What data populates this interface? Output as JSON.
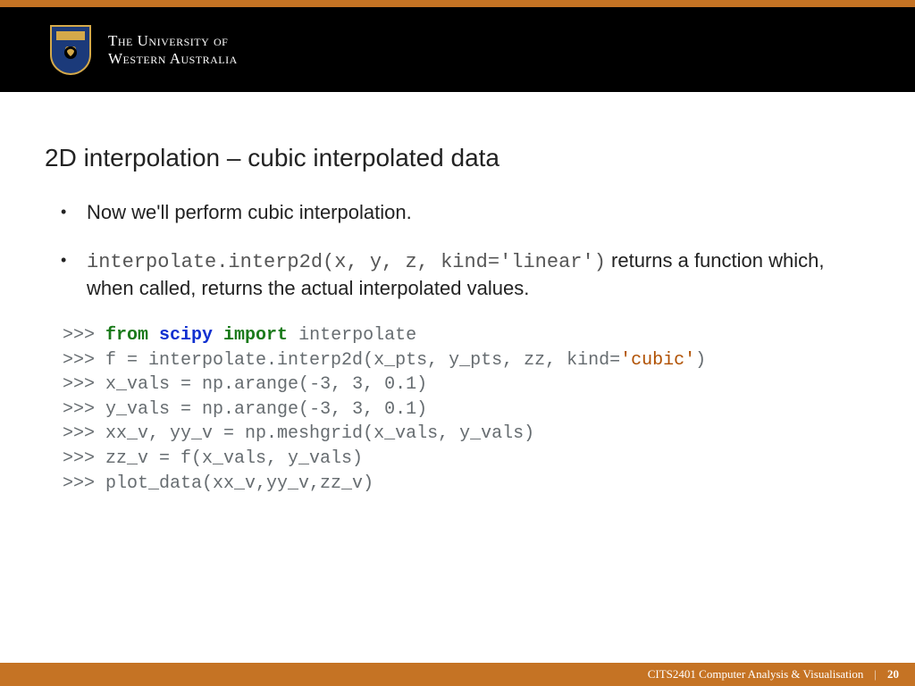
{
  "header": {
    "uni_line1": "The University of",
    "uni_line2": "Western Australia"
  },
  "title": "2D interpolation – cubic interpolated data",
  "bullets": {
    "b1": "Now we'll perform cubic interpolation.",
    "b2_code": "interpolate.interp2d(x, y, z, kind='linear')",
    "b2_rest": " returns a function which, when called, returns the actual interpolated values."
  },
  "code": {
    "l1_prompt": ">>> ",
    "l1_from": "from",
    "l1_scipy": " scipy ",
    "l1_import": "import",
    "l1_rest": " interpolate",
    "l2_prompt": ">>> ",
    "l2_a": "f = interpolate.interp2d(x_pts, y_pts, zz, kind=",
    "l2_str": "'cubic'",
    "l2_b": ")",
    "l3_prompt": ">>> ",
    "l3_a": "x_vals = np.arange(",
    "l3_n1": "-3",
    "l3_c1": ", ",
    "l3_n2": "3",
    "l3_c2": ", ",
    "l3_n3": "0.1",
    "l3_b": ")",
    "l4_prompt": ">>> ",
    "l4_a": "y_vals = np.arange(",
    "l4_n1": "-3",
    "l4_c1": ", ",
    "l4_n2": "3",
    "l4_c2": ", ",
    "l4_n3": "0.1",
    "l4_b": ")",
    "l5_prompt": ">>> ",
    "l5_a": "xx_v, yy_v = np.meshgrid(x_vals, y_vals)",
    "l6_prompt": ">>> ",
    "l6_a": "zz_v = f(x_vals, y_vals)",
    "l7_prompt": ">>> ",
    "l7_a": "plot_data(xx_v,yy_v,zz_v)"
  },
  "footer": {
    "course": "CITS2401 Computer Analysis & Visualisation",
    "page": "20"
  }
}
